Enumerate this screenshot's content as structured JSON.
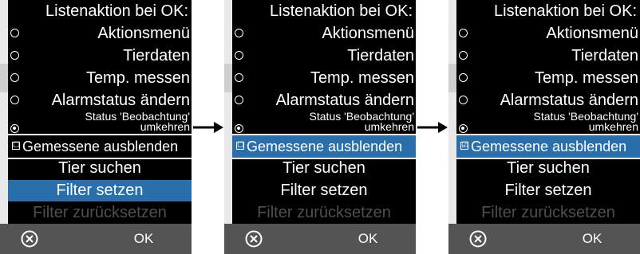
{
  "panels": [
    {
      "title": "Listenaktion bei OK:",
      "options": [
        "Aktionsmenü",
        "Tierdaten",
        "Temp. messen",
        "Alarmstatus ändern"
      ],
      "status_lines": [
        "Status 'Beobachtung'",
        "umkehren"
      ],
      "selected_option": 4,
      "checkbox": {
        "label": "Gemessene ausblenden",
        "checked": false,
        "highlighted": false,
        "mark": "☐"
      },
      "actions": [
        "Tier suchen",
        "Filter setzen",
        "Filter zurücksetzen"
      ],
      "selected_action": 1,
      "disabled_action": 2,
      "footer": {
        "cancel_icon": "cancel-circle-icon",
        "ok_label": "OK"
      }
    },
    {
      "title": "Listenaktion bei OK:",
      "options": [
        "Aktionsmenü",
        "Tierdaten",
        "Temp. messen",
        "Alarmstatus ändern"
      ],
      "status_lines": [
        "Status 'Beobachtung'",
        "umkehren"
      ],
      "selected_option": 4,
      "checkbox": {
        "label": "Gemessene ausblenden",
        "checked": false,
        "highlighted": true,
        "mark": "☐"
      },
      "actions": [
        "Tier suchen",
        "Filter setzen",
        "Filter zurücksetzen"
      ],
      "selected_action": -1,
      "disabled_action": 2,
      "footer": {
        "cancel_icon": "cancel-circle-icon",
        "ok_label": "OK"
      }
    },
    {
      "title": "Listenaktion bei OK:",
      "options": [
        "Aktionsmenü",
        "Tierdaten",
        "Temp. messen",
        "Alarmstatus ändern"
      ],
      "status_lines": [
        "Status 'Beobachtung'",
        "umkehren"
      ],
      "selected_option": 4,
      "checkbox": {
        "label": "Gemessene ausblenden",
        "checked": true,
        "highlighted": true,
        "mark": "☑"
      },
      "actions": [
        "Tier suchen",
        "Filter setzen",
        "Filter zurücksetzen"
      ],
      "selected_action": -1,
      "disabled_action": 2,
      "footer": {
        "cancel_icon": "cancel-circle-icon",
        "ok_label": "OK"
      }
    }
  ],
  "colors": {
    "highlight": "#2a6fab",
    "background": "#000000",
    "footer": "#545454",
    "disabled_text": "#4f4f4f"
  }
}
